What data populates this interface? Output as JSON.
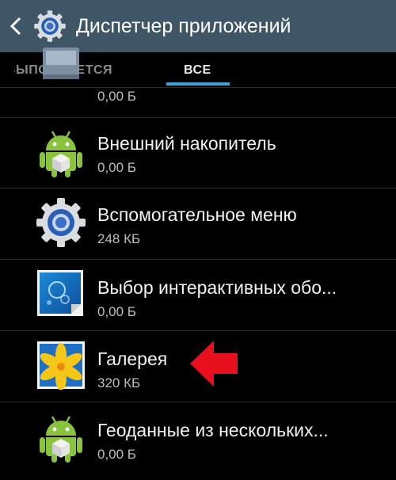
{
  "header": {
    "title": "Диспетчер приложений",
    "back_icon": "chevron-left-icon",
    "app_icon": "gear-icon",
    "background": "#3f5667"
  },
  "tabs": [
    {
      "label": "ВЫПОЛНЯЕТСЯ",
      "active": false
    },
    {
      "label": "ВСЕ",
      "active": true
    }
  ],
  "accent": "#3ba3d9",
  "apps": [
    {
      "name": "",
      "size": "0,00 Б",
      "icon": "sd-card-icon"
    },
    {
      "name": "Внешний накопитель",
      "size": "0,00 Б",
      "icon": "android-icon"
    },
    {
      "name": "Вспомогательное меню",
      "size": "248 КБ",
      "icon": "gear-icon"
    },
    {
      "name": "Выбор интерактивных обо...",
      "size": "0,00 Б",
      "icon": "live-wallpaper-icon"
    },
    {
      "name": "Галерея",
      "size": "320 КБ",
      "icon": "gallery-icon"
    },
    {
      "name": "Геоданные из нескольких...",
      "size": "0,00 Б",
      "icon": "android-icon"
    }
  ],
  "annotation": {
    "icon": "red-arrow-left-icon",
    "color": "#e8101c"
  }
}
